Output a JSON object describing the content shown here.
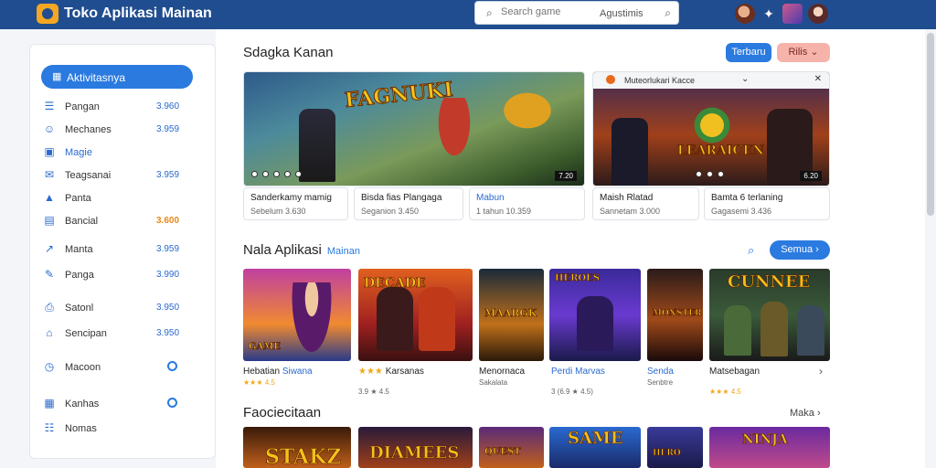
{
  "app": {
    "title": "Toko Aplikasi Mainan"
  },
  "search": {
    "placeholder": "Search game",
    "hint": "Agustimis"
  },
  "sidebar": {
    "items": [
      {
        "label": "Aktivitasnya",
        "icon": "grid-icon",
        "count": "",
        "active": true
      },
      {
        "label": "Pangan",
        "icon": "list-icon",
        "count": "3.960"
      },
      {
        "label": "Mechanes",
        "icon": "smile-icon",
        "count": "3.959"
      },
      {
        "label": "Magie",
        "icon": "box-icon",
        "count": ""
      },
      {
        "label": "Teagsanai",
        "icon": "chat-icon",
        "count": "3.959"
      },
      {
        "label": "Panta",
        "icon": "image-icon",
        "count": ""
      },
      {
        "label": "Bancial",
        "icon": "table-icon",
        "count": "3.600"
      },
      {
        "label": "Manta",
        "icon": "chart-icon",
        "count": "3.959"
      },
      {
        "label": "Panga",
        "icon": "edit-icon",
        "count": "3.990"
      },
      {
        "label": "Satonl",
        "icon": "print-icon",
        "count": "3.950"
      },
      {
        "label": "Sencipan",
        "icon": "lock-icon",
        "count": "3.950"
      },
      {
        "label": "Macoon",
        "icon": "clock-icon",
        "count": ""
      },
      {
        "label": "Kanhas",
        "icon": "calendar-icon",
        "count": ""
      },
      {
        "label": "Nomas",
        "icon": "apps-icon",
        "count": ""
      }
    ]
  },
  "featured": {
    "title": "Sdagka Kanan",
    "btn_primary": "Terbaru",
    "btn_secondary": "Rilis",
    "banner1": {
      "heading": "FAGNUKI",
      "badge": "7.20"
    },
    "banner2": {
      "heading": "LEARAICEN",
      "badge": "6.20",
      "tab_label": "Muteorlukari Kacce",
      "tab_chevron": "⌄",
      "tab_close": "✕"
    },
    "cards": [
      {
        "title": "Sanderkamy mamig",
        "meta": "Sebelum 3.630"
      },
      {
        "title": "Bisda fias Plangaga",
        "meta": "Seganion 3.450"
      },
      {
        "title": "Mabun",
        "meta": "1 tahun 10.359"
      },
      {
        "title": "Maish Rlatad",
        "meta": "Sannetam 3.000"
      },
      {
        "title": "Bamta 6 terlaning",
        "meta": "Gagasemi 3.436"
      }
    ]
  },
  "new_apps": {
    "title": "Nala Aplikasi",
    "subtitle": "Mainan",
    "button": "Semua",
    "games": [
      {
        "tile": "GAME",
        "title": "Hebatian",
        "title2": "Siwana",
        "meta": "★★★ 4.5"
      },
      {
        "tile": "DECADE",
        "title": "Karsanas",
        "prefix": "★★★",
        "meta": "3.9 ★ 4.5"
      },
      {
        "tile": "MAARGK",
        "title": "Menornaca",
        "meta": "Sakalata"
      },
      {
        "tile": "HEROES",
        "title": "Perdi Marvas",
        "meta": "3 (6.9 ★ 4.5)"
      },
      {
        "tile": "MONSTER",
        "title": "Senda",
        "meta": "Senbtre"
      },
      {
        "tile": "CUNNEE",
        "title": "Matsebagan",
        "meta": "★★★ 4.5",
        "chevron": "›"
      }
    ]
  },
  "favorites": {
    "title": "Faociecitaan",
    "more": "Maka",
    "tiles": [
      {
        "tile": "STAKZ"
      },
      {
        "tile": "DIAMEES"
      },
      {
        "tile": "QUEST"
      },
      {
        "tile": "SAME"
      },
      {
        "tile": "HERO"
      },
      {
        "tile": "NINJA"
      }
    ]
  },
  "colors": {
    "topbar": "#1f4d8f",
    "accent": "#2a7ae0",
    "secondary": "#f6b3aa"
  }
}
